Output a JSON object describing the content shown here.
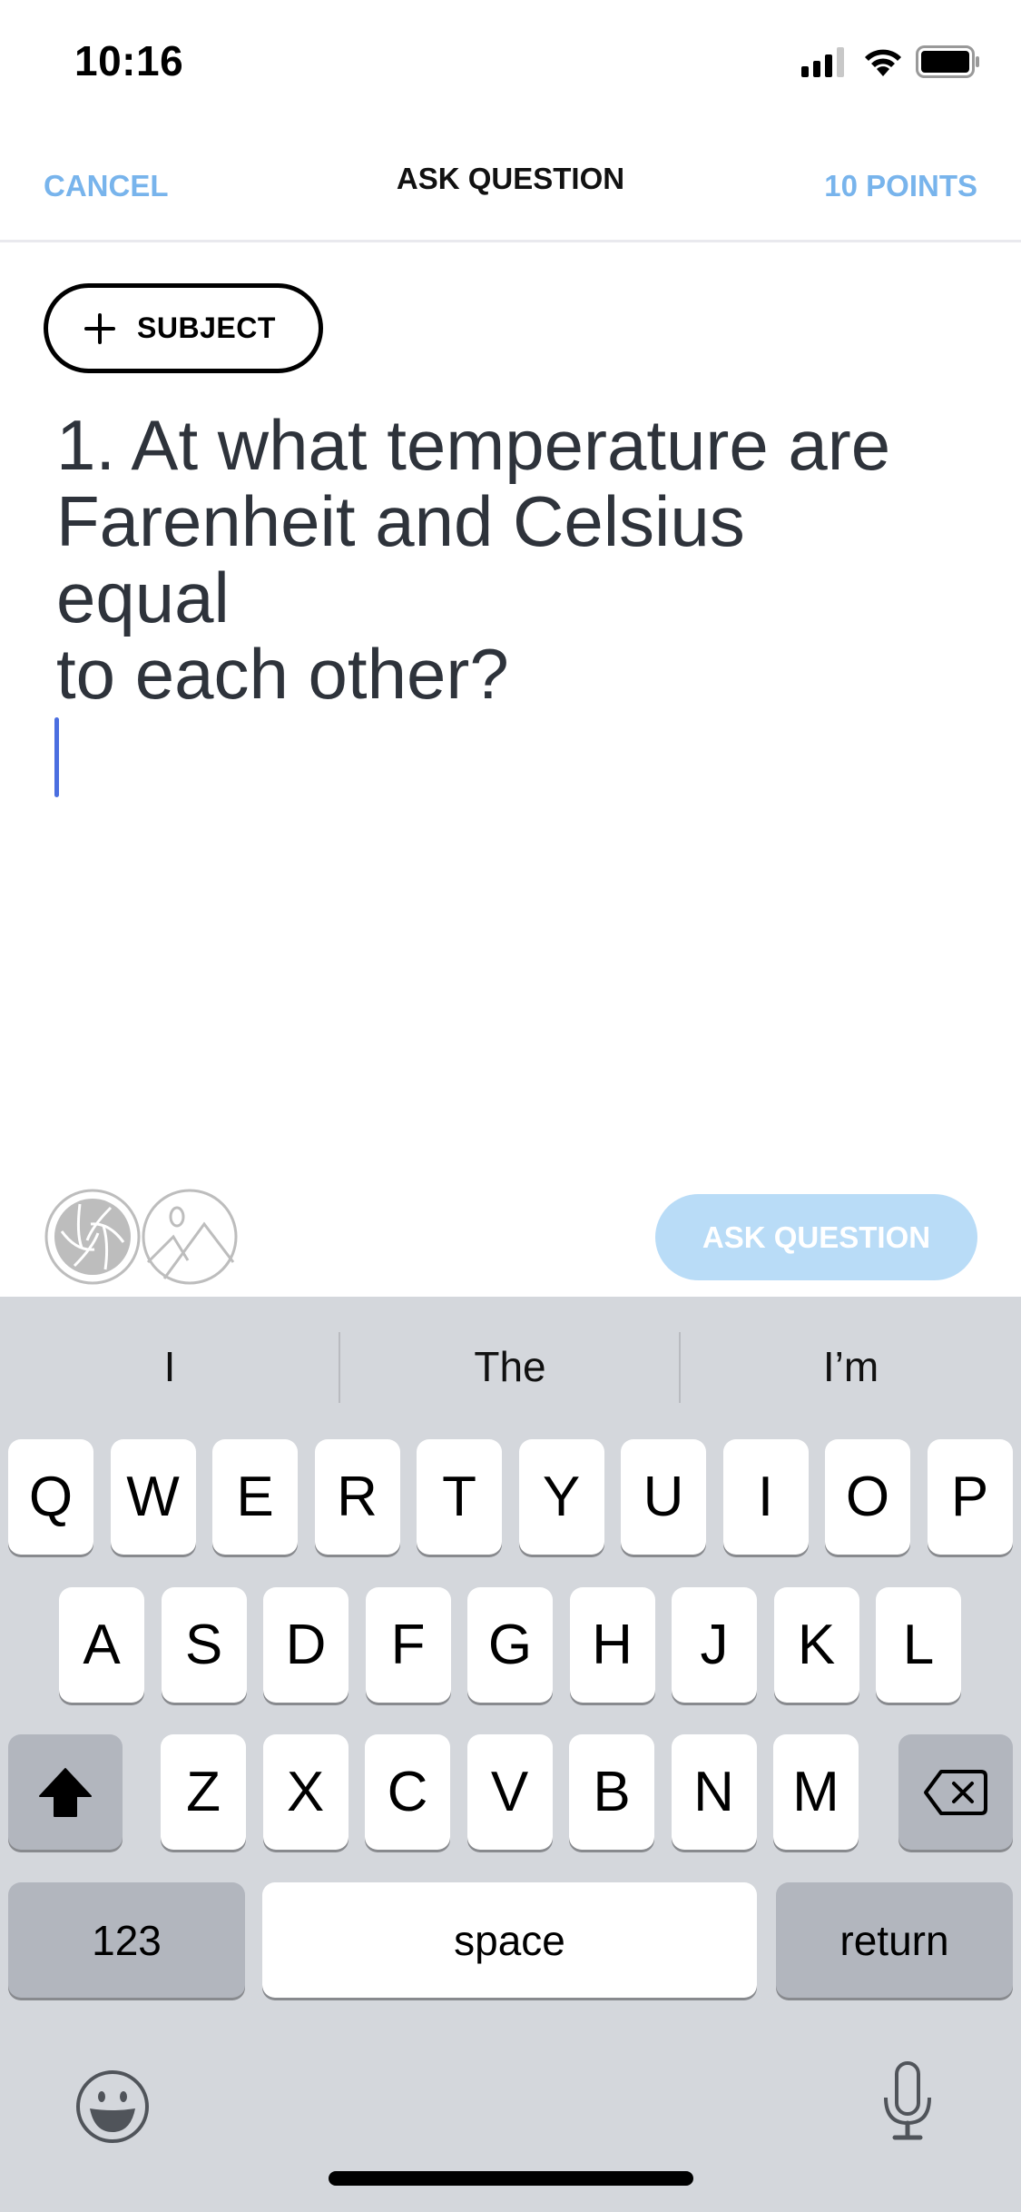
{
  "status_bar": {
    "time": "10:16",
    "icons": [
      "signal-icon",
      "wifi-icon",
      "battery-icon"
    ]
  },
  "nav": {
    "cancel_label": "CANCEL",
    "title": "ASK QUESTION",
    "points_label": "10 POINTS"
  },
  "subject_button": {
    "icon": "plus-icon",
    "label": "SUBJECT"
  },
  "question": {
    "lines": [
      "1. At what temperature are",
      "Farenheit and Celsius",
      "equal",
      "to each other?"
    ]
  },
  "attachments": {
    "camera_icon": "camera-shutter-icon",
    "photo_icon": "photo-library-icon"
  },
  "ask_button": {
    "label": "ASK QUESTION",
    "color": "#b9dcf7"
  },
  "colors": {
    "accent": "#78b4ec",
    "caret": "#4a6ee0",
    "keyboard_bg": "#d4d7dc"
  },
  "keyboard": {
    "suggestions": [
      "I",
      "The",
      "I’m"
    ],
    "row1": [
      "Q",
      "W",
      "E",
      "R",
      "T",
      "Y",
      "U",
      "I",
      "O",
      "P"
    ],
    "row2": [
      "A",
      "S",
      "D",
      "F",
      "G",
      "H",
      "J",
      "K",
      "L"
    ],
    "row3": [
      "Z",
      "X",
      "C",
      "V",
      "B",
      "N",
      "M"
    ],
    "shift_icon": "shift-icon",
    "delete_icon": "delete-icon",
    "numbers_label": "123",
    "space_label": "space",
    "return_label": "return",
    "emoji_icon": "emoji-icon",
    "mic_icon": "microphone-icon"
  }
}
